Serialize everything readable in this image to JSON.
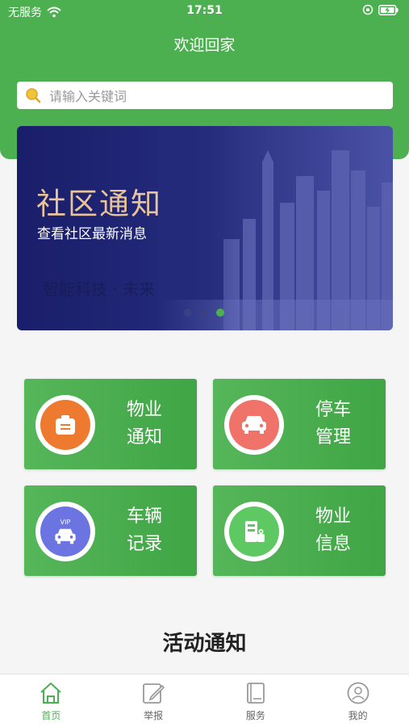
{
  "statusbar": {
    "carrier": "无服务",
    "time": "17:51"
  },
  "header": {
    "title": "欢迎回家"
  },
  "search": {
    "placeholder": "请输入关键词"
  },
  "banner": {
    "title": "社区通知",
    "subtitle": "查看社区最新消息",
    "faint_text": "智能科技 · 未来",
    "dots": 3,
    "active_dot": 3
  },
  "cards": [
    {
      "line1": "物业",
      "line2": "通知",
      "icon": "message-icon",
      "color": "#ee7a2f"
    },
    {
      "line1": "停车",
      "line2": "管理",
      "icon": "car-icon",
      "color": "#f0736a"
    },
    {
      "line1": "车辆",
      "line2": "记录",
      "icon": "vip-car-icon",
      "color": "#6b74e0",
      "badge": "VIP"
    },
    {
      "line1": "物业",
      "line2": "信息",
      "icon": "building-icon",
      "color": "#5ec962"
    }
  ],
  "section": {
    "title": "活动通知"
  },
  "tabs": [
    {
      "label": "首页",
      "icon": "home-icon",
      "active": true
    },
    {
      "label": "举报",
      "icon": "edit-icon",
      "active": false
    },
    {
      "label": "服务",
      "icon": "book-icon",
      "active": false
    },
    {
      "label": "我的",
      "icon": "user-icon",
      "active": false
    }
  ],
  "colors": {
    "brand": "#4caf50",
    "banner_title": "#e9c49a"
  }
}
